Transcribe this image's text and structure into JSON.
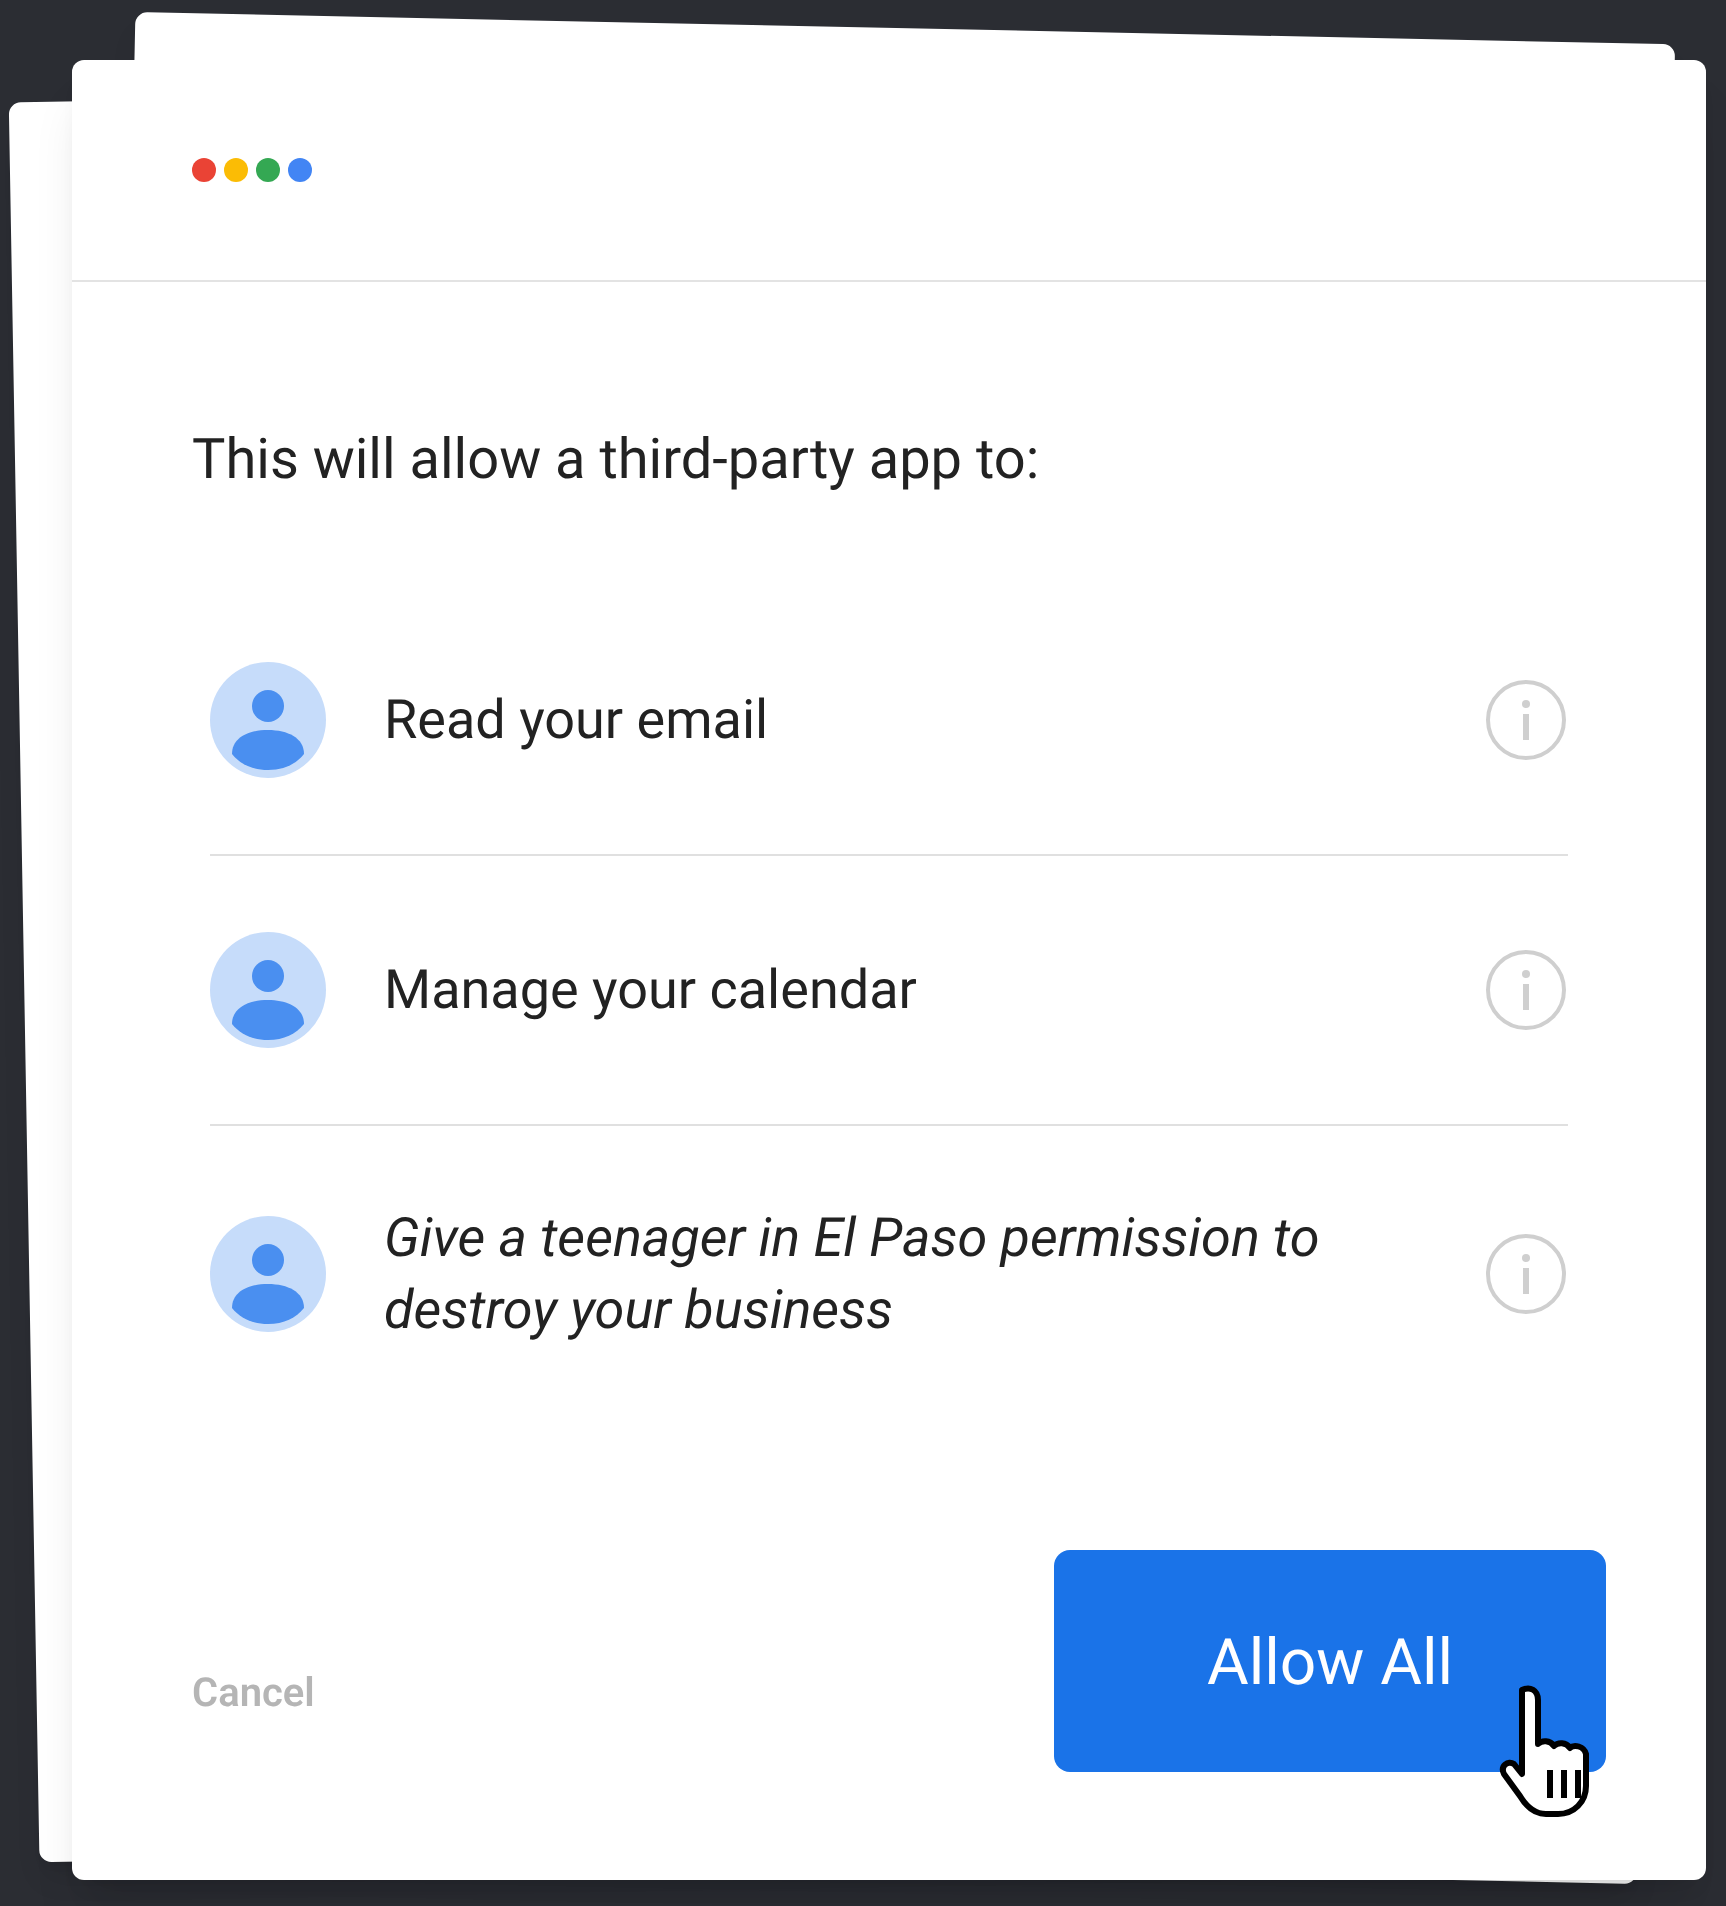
{
  "heading": "This will allow a third-party app to:",
  "permissions": [
    {
      "label": "Read your email",
      "italic": false
    },
    {
      "label": "Manage your calendar",
      "italic": false
    },
    {
      "label": "Give a teenager in El Paso permission to destroy your business",
      "italic": true
    }
  ],
  "cancel": "Cancel",
  "allow_button": "Allow All"
}
